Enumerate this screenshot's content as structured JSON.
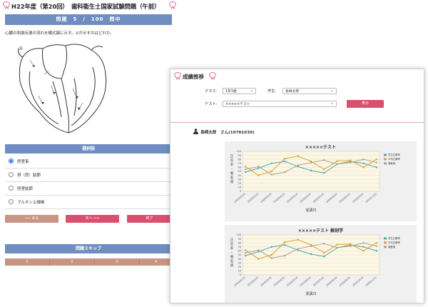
{
  "exam": {
    "title": "H22年度（第20回）　歯科衛生士国家試験問題（午前）",
    "question_bar": "問題　5　/　100　問中",
    "question_text": "心臓の刺激伝導の流れを模式図に示す。①が示すのはどれか。",
    "diagram_marker": "①",
    "choices_header": "選択肢",
    "choices": [
      {
        "label": "房室束",
        "selected": true
      },
      {
        "label": "洞（房）結節",
        "selected": false
      },
      {
        "label": "房室結節",
        "selected": false
      },
      {
        "label": "プルキンエ線維",
        "selected": false
      }
    ],
    "buttons": {
      "back": "<< 戻る",
      "next": "次へ >>",
      "end": "終了"
    },
    "skip_header": "問題スキップ",
    "skip_items": [
      "1",
      "2",
      "3",
      "4"
    ]
  },
  "results": {
    "title": "成績推移",
    "class_label": "クラス:",
    "class_value": "1年1組",
    "student_label": "学生:",
    "student_value": "長崎太郎",
    "test_label": "テスト:",
    "test_value": "×××××テスト",
    "show_button": "表示",
    "student_info": "長崎太郎　さん(19781030)"
  },
  "colors": {
    "header_blue": "#6f8dc0",
    "pink_button": "#d9506e",
    "brown_button": "#c89484",
    "series_blue": "#4aa8b8",
    "series_orange": "#e0a030",
    "series_gray": "#b0a090"
  },
  "chart_data": [
    {
      "type": "line",
      "title": "×××××テスト",
      "xlabel": "受講日",
      "ylabel": "正答率・偏差値",
      "ylim": [
        0,
        100
      ],
      "yticks": [
        0,
        10,
        20,
        30,
        40,
        50,
        60,
        70,
        80,
        90,
        100
      ],
      "categories": [
        "2020/01/10",
        "2020/02/10",
        "2020/03/10",
        "2020/04/10",
        "2020/05/10",
        "2020/06/10",
        "2020/07/10",
        "2020/08/10",
        "2020/09/10",
        "2020/10/10",
        "2020/11/10"
      ],
      "series": [
        {
          "name": "学生正解率",
          "values": [
            48,
            58,
            70,
            75,
            62,
            52,
            46,
            68,
            75,
            70,
            60
          ]
        },
        {
          "name": "平均正解率",
          "values": [
            62,
            40,
            50,
            82,
            88,
            75,
            55,
            76,
            77,
            60,
            80
          ]
        },
        {
          "name": "偏差値",
          "values": [
            55,
            62,
            42,
            48,
            65,
            72,
            78,
            68,
            72,
            80,
            72
          ]
        }
      ],
      "legend": "right"
    },
    {
      "type": "line",
      "title": "×××××テスト 解剖学",
      "xlabel": "受講日",
      "ylabel": "正答率・偏差値",
      "ylim": [
        0,
        100
      ],
      "yticks": [
        0,
        10,
        20,
        30,
        40,
        50,
        60,
        70,
        80,
        90,
        100
      ],
      "categories": [
        "2020/01/10",
        "2020/02/10",
        "2020/03/10",
        "2020/04/10",
        "2020/05/10",
        "2020/06/10",
        "2020/07/10",
        "2020/08/10",
        "2020/09/10",
        "2020/10/10",
        "2020/11/10"
      ],
      "series": [
        {
          "name": "学生正解率",
          "values": [
            48,
            58,
            70,
            75,
            62,
            52,
            46,
            68,
            75,
            70,
            60
          ]
        },
        {
          "name": "平均正解率",
          "values": [
            62,
            40,
            50,
            82,
            88,
            75,
            55,
            76,
            77,
            60,
            80
          ]
        },
        {
          "name": "偏差値",
          "values": [
            55,
            62,
            42,
            48,
            65,
            72,
            78,
            68,
            72,
            80,
            72
          ]
        }
      ],
      "legend": "right"
    }
  ]
}
